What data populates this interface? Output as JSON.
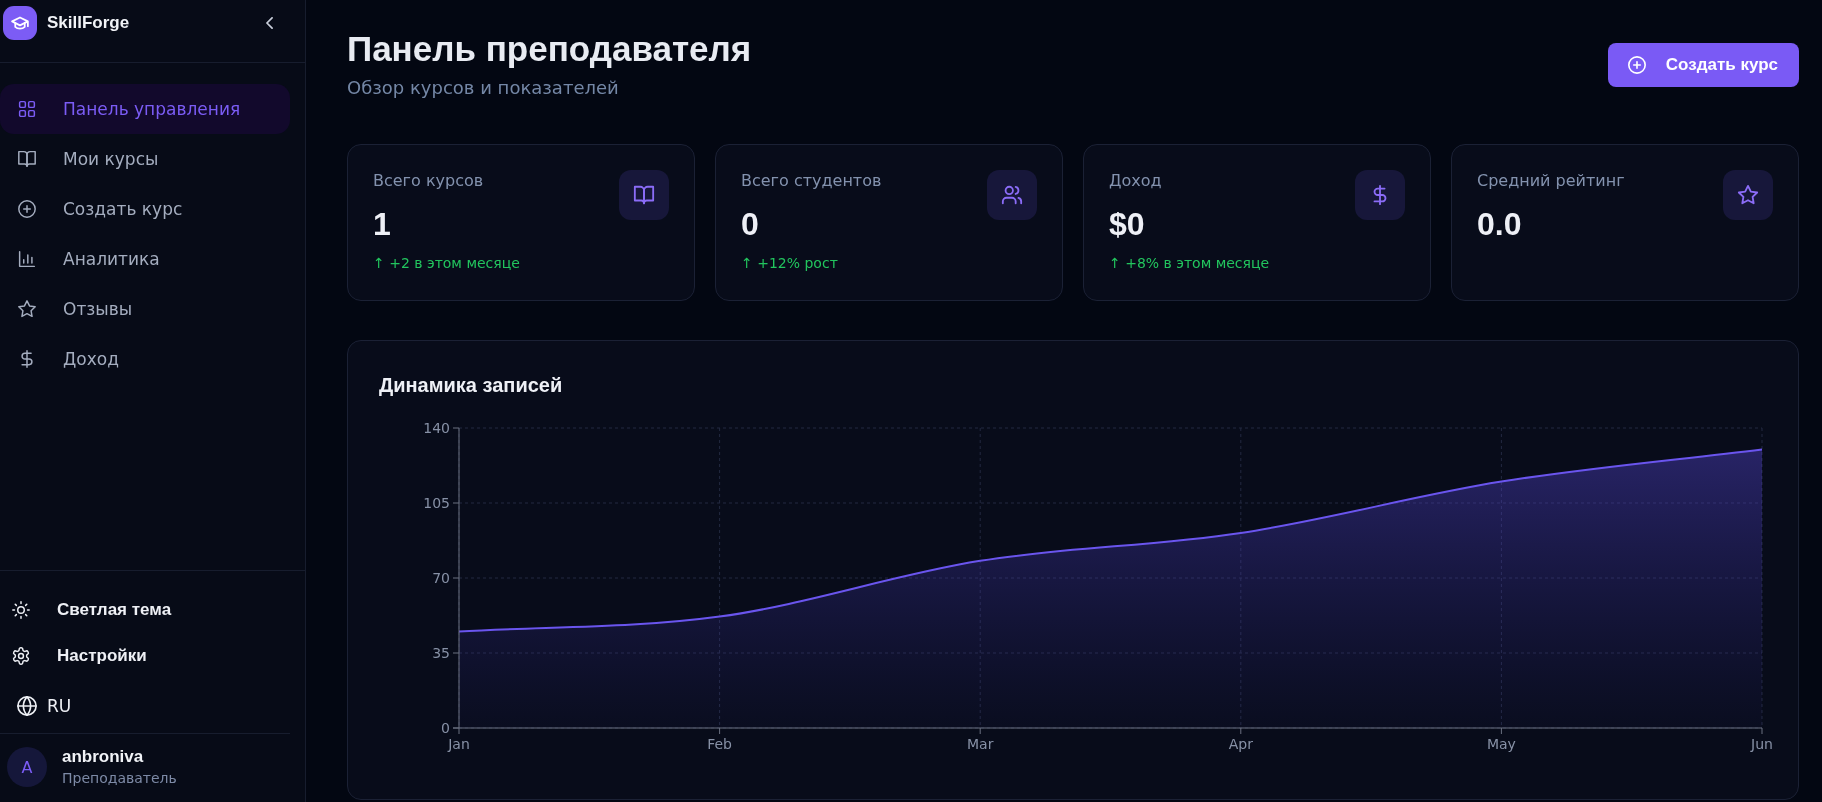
{
  "sidebar": {
    "brand": "SkillForge",
    "nav": [
      {
        "label": "Панель управления",
        "selected": true
      },
      {
        "label": "Мои курсы",
        "selected": false
      },
      {
        "label": "Создать курс",
        "selected": false
      },
      {
        "label": "Аналитика",
        "selected": false
      },
      {
        "label": "Отзывы",
        "selected": false
      },
      {
        "label": "Доход",
        "selected": false
      }
    ],
    "footer_links": [
      "Светлая тема",
      "Настройки"
    ],
    "language": "RU",
    "user": {
      "initial": "A",
      "name": "anbroniva",
      "role": "Преподаватель"
    }
  },
  "header": {
    "title": "Панель преподавателя",
    "subtitle": "Обзор курсов и показателей",
    "action": "Создать курс"
  },
  "stats": [
    {
      "label": "Всего курсов",
      "value": "1",
      "trend": "↑ +2 в этом месяце"
    },
    {
      "label": "Всего студентов",
      "value": "0",
      "trend": "↑ +12% рост"
    },
    {
      "label": "Доход",
      "value": "$0",
      "trend": "↑ +8% в этом месяце"
    },
    {
      "label": "Средний рейтинг",
      "value": "0.0"
    }
  ],
  "chart_card": {
    "chart_data": {
      "type": "area",
      "title": "Динамика записей",
      "categories": [
        "Jan",
        "Feb",
        "Mar",
        "Apr",
        "May",
        "Jun"
      ],
      "values": [
        45,
        52,
        78,
        91,
        115,
        130
      ],
      "ylim": [
        0,
        140
      ],
      "yticks": [
        0,
        35,
        70,
        105,
        140
      ],
      "grid": true
    }
  }
}
